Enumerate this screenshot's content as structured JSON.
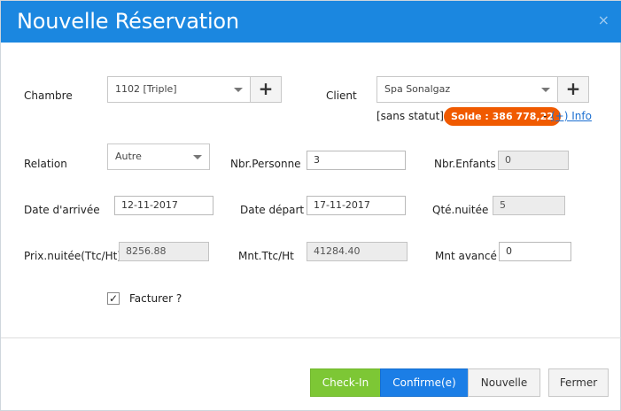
{
  "modal": {
    "title": "Nouvelle Réservation",
    "close_glyph": "×"
  },
  "labels": {
    "chambre": "Chambre",
    "client": "Client",
    "relation": "Relation",
    "nbr_personne": "Nbr.Personne",
    "nbr_enfants": "Nbr.Enfants",
    "date_arrivee": "Date d'arrivée",
    "date_depart": "Date départ",
    "qte_nuitee": "Qté.nuitée",
    "prix_nuitee": "Prix.nuitée(Ttc/Ht)",
    "mnt_ttc": "Mnt.Ttc/Ht",
    "mnt_avance": "Mnt avancé",
    "facturer": "Facturer ?"
  },
  "fields": {
    "chambre": "1102 [Triple]",
    "client": "Spa Sonalgaz",
    "relation": "Autre",
    "nbr_personne": "3",
    "nbr_enfants": "0",
    "date_arrivee": "12-11-2017",
    "date_depart": "17-11-2017",
    "qte_nuitee": "5",
    "prix_nuitee": "8256.88",
    "mnt_ttc": "41284.40",
    "mnt_avance": "0",
    "facturer_checked": true
  },
  "client_info": {
    "status": "[sans statut]",
    "solde_badge": "Solde : 386 778,22",
    "info_link": "(+) Info",
    "badge_color": "#f05a00"
  },
  "buttons": {
    "plus_glyph": "+",
    "checkin": "Check-In",
    "confirme": "Confirme(e)",
    "nouvelle": "Nouvelle",
    "fermer": "Fermer"
  },
  "colors": {
    "header": "#1b87e0",
    "checkin": "#7dc735",
    "confirme": "#1b7ee6"
  }
}
